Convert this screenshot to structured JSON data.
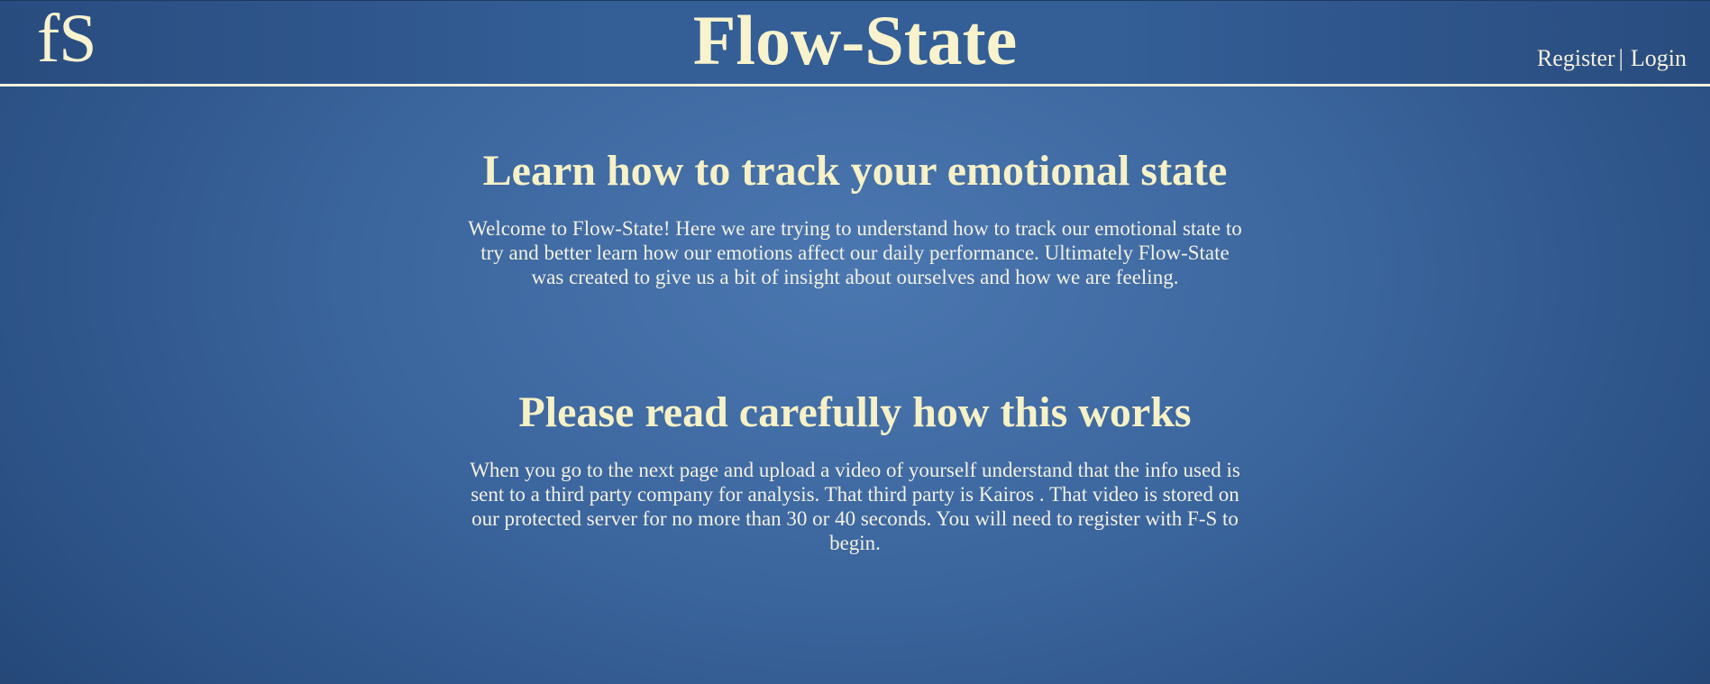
{
  "header": {
    "logo_text": "fS",
    "title": "Flow-State",
    "nav": {
      "register_label": "Register",
      "separator": "|",
      "login_label": "Login"
    }
  },
  "sections": [
    {
      "heading": "Learn how to track your emotional state",
      "body": "Welcome to Flow-State! Here we are trying to understand how to track our emotional state to try and better learn how our emotions affect our daily performance. Ultimately Flow-State was created to give us a bit of insight about ourselves and how we are feeling."
    },
    {
      "heading": "Please read carefully how this works",
      "body": "When you go to the next page and upload a video of yourself understand that the info used is sent to a third party company for analysis. That third party is Kairos . That video is stored on our protected server for no more than 30 or 40 seconds. You will need to register with F-S to begin."
    }
  ],
  "colors": {
    "heading_text": "#f6f1c6",
    "body_text": "#f3f1e2",
    "background_center": "#4b77b0",
    "background_edge": "#1c3c68",
    "header_rule": "#f4f2dc"
  }
}
